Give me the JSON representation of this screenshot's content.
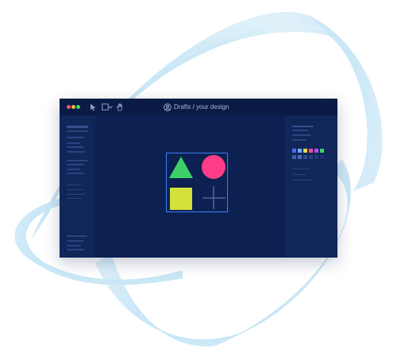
{
  "window": {
    "breadcrumb": "Drafts / your design",
    "traffic_lights": [
      "#f25b6a",
      "#f5b73b",
      "#3ddc6e"
    ]
  },
  "toolbar": {
    "tools": [
      "pointer-icon",
      "frame-icon",
      "chevron-down-icon",
      "hand-icon"
    ]
  },
  "canvas": {
    "shapes": [
      {
        "name": "triangle",
        "color": "#3ecf6a"
      },
      {
        "name": "circle",
        "color": "#ff3d86"
      },
      {
        "name": "square",
        "color": "#d4e03c"
      },
      {
        "name": "plus",
        "color": "#5b73a8"
      }
    ],
    "cursor_color": "#b04dff",
    "selection_color": "#3d7ff5"
  },
  "colors": {
    "palette_row_1": [
      "#4b6bff",
      "#6fa8ff",
      "#e4d84a",
      "#ff4d8a",
      "#b04dff",
      "#3ecf6a"
    ],
    "palette_row_2": [
      "#3f5fa8",
      "#4a6ab8",
      "#2e4a8a",
      "#27427e",
      "#22397a",
      "#1b2f66"
    ],
    "window_bg": "#0c2152",
    "swirl": "#9fd4f0"
  }
}
